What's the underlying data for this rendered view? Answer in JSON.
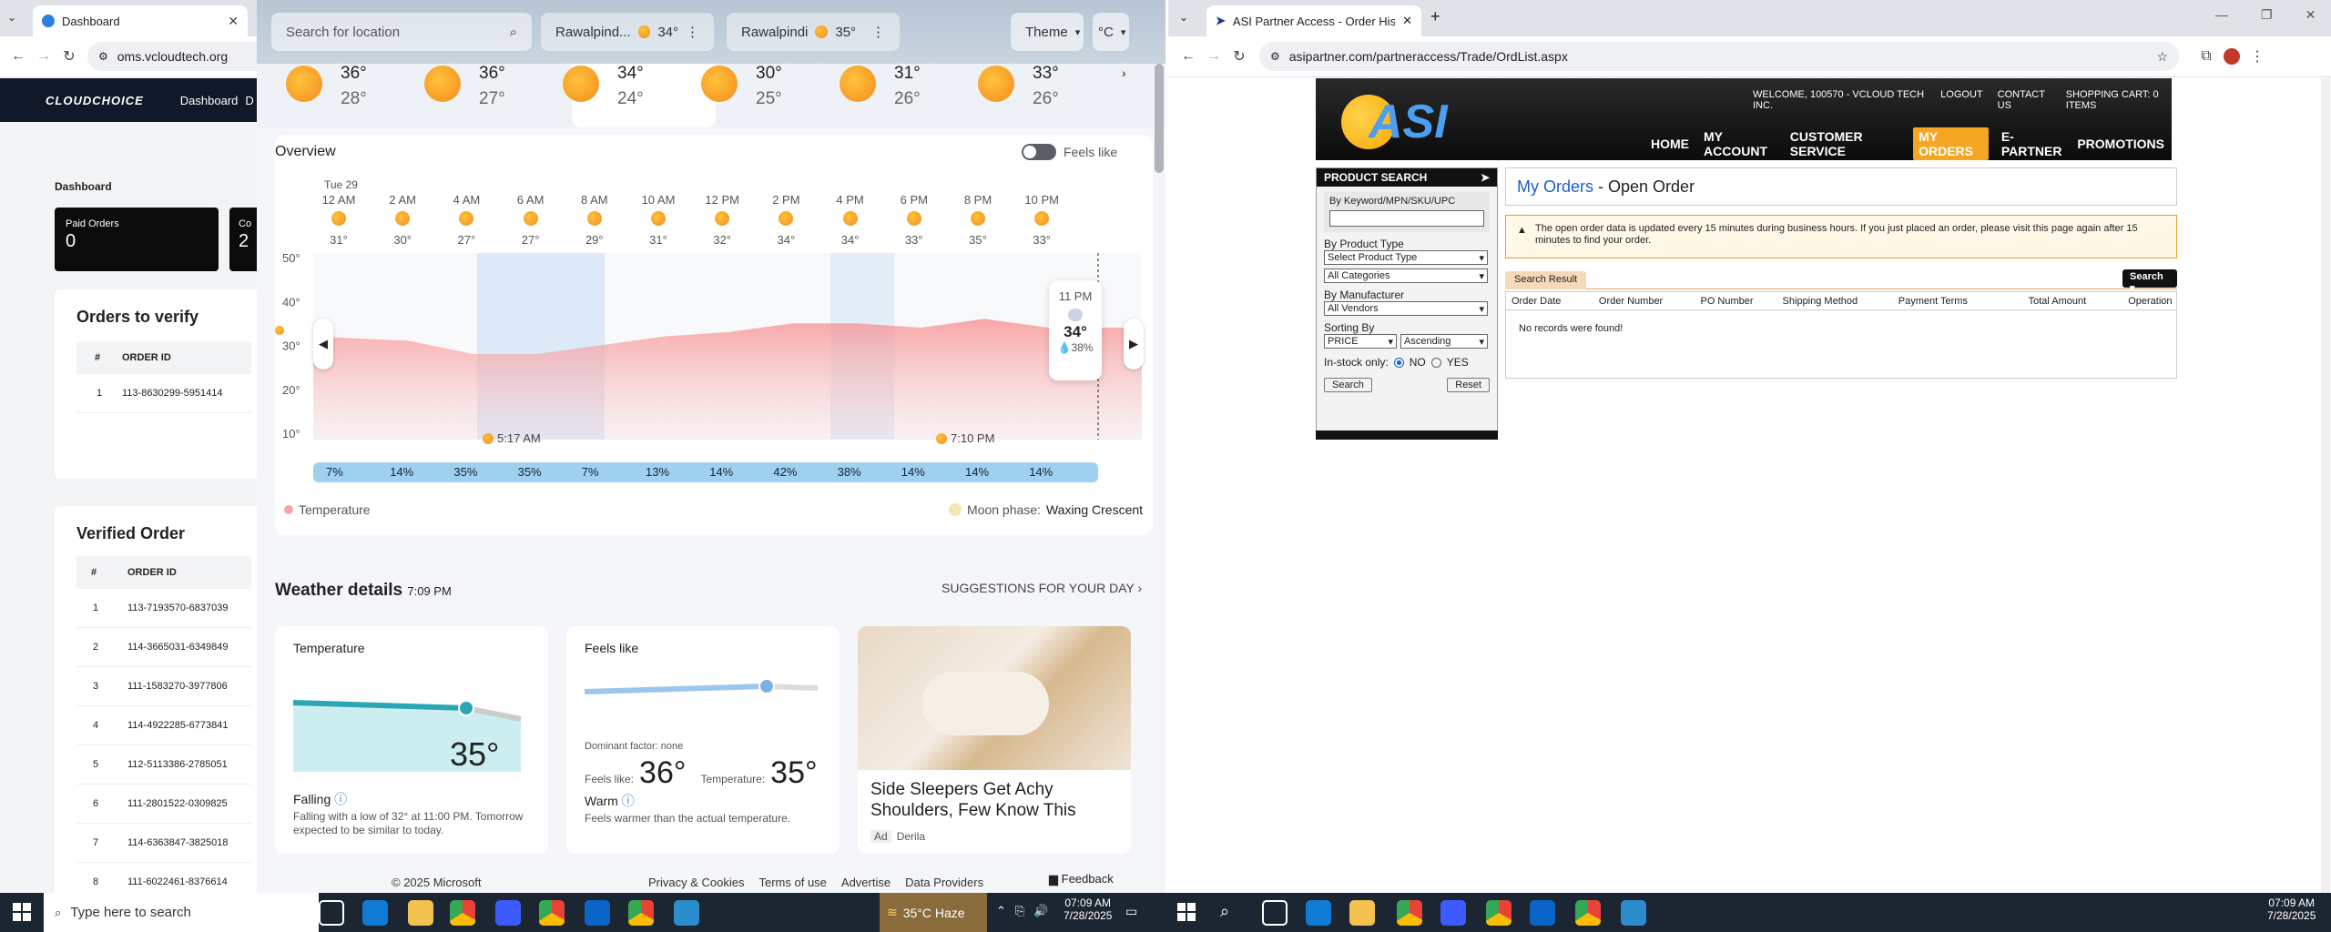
{
  "left_browser": {
    "tab_title": "Dashboard",
    "url": "oms.vcloudtech.org",
    "cc": {
      "logo": "CLOUDCHOICE",
      "nav_dashboard": "Dashboard",
      "nav_next": "D",
      "breadcrumb": "Dashboard",
      "paid_orders_label": "Paid Orders",
      "paid_orders_value": "0",
      "co_label": "Co",
      "co_value": "2",
      "orders_to_verify_title": "Orders to verify",
      "col_num": "#",
      "col_order_id": "ORDER ID",
      "verify_rows": [
        {
          "n": "1",
          "id": "113-8630299-5951414"
        }
      ],
      "verified_title": "Verified Order",
      "verified_rows": [
        {
          "n": "1",
          "id": "113-7193570-6837039"
        },
        {
          "n": "2",
          "id": "114-3665031-6349849"
        },
        {
          "n": "3",
          "id": "111-1583270-3977806"
        },
        {
          "n": "4",
          "id": "114-4922285-6773841"
        },
        {
          "n": "5",
          "id": "112-5113386-2785051"
        },
        {
          "n": "6",
          "id": "111-2801522-0309825"
        },
        {
          "n": "7",
          "id": "114-6363847-3825018"
        },
        {
          "n": "8",
          "id": "111-6022461-8376614"
        }
      ]
    }
  },
  "weather": {
    "search_placeholder": "Search for location",
    "loc1_name": "Rawalpind...",
    "loc1_temp": "34°",
    "loc2_name": "Rawalpindi",
    "loc2_temp": "35°",
    "theme_label": "Theme",
    "unit_label": "°C",
    "days": [
      {
        "hi": "36°",
        "lo": "28°"
      },
      {
        "hi": "36°",
        "lo": "27°"
      },
      {
        "hi": "34°",
        "lo": "24°"
      },
      {
        "hi": "30°",
        "lo": "25°"
      },
      {
        "hi": "31°",
        "lo": "26°"
      },
      {
        "hi": "33°",
        "lo": "26°"
      }
    ],
    "overview_title": "Overview",
    "feels_like_toggle": "Feels like",
    "date_label": "Tue 29",
    "hours": [
      {
        "t": "12 AM",
        "v": "31°"
      },
      {
        "t": "2 AM",
        "v": "30°"
      },
      {
        "t": "4 AM",
        "v": "27°"
      },
      {
        "t": "6 AM",
        "v": "27°"
      },
      {
        "t": "8 AM",
        "v": "29°"
      },
      {
        "t": "10 AM",
        "v": "31°"
      },
      {
        "t": "12 PM",
        "v": "32°"
      },
      {
        "t": "2 PM",
        "v": "34°"
      },
      {
        "t": "4 PM",
        "v": "34°"
      },
      {
        "t": "6 PM",
        "v": "33°"
      },
      {
        "t": "8 PM",
        "v": "35°"
      },
      {
        "t": "10 PM",
        "v": "33°"
      }
    ],
    "y_ticks": [
      "50°",
      "40°",
      "30°",
      "20°",
      "10°"
    ],
    "sunrise": "5:17 AM",
    "sunset": "7:10 PM",
    "tooltip_time": "11 PM",
    "tooltip_temp": "34°",
    "tooltip_rain": "38%",
    "rain": [
      "7%",
      "14%",
      "35%",
      "35%",
      "7%",
      "13%",
      "14%",
      "42%",
      "38%",
      "14%",
      "14%",
      "14%"
    ],
    "legend_temperature": "Temperature",
    "moon_label": "Moon phase:",
    "moon_value": "Waxing Crescent",
    "details_title": "Weather details",
    "details_time": "7:09 PM",
    "suggestions": "SUGGESTIONS FOR YOUR DAY",
    "temp_card_title": "Temperature",
    "temp_card_value": "35°",
    "temp_card_status": "Falling",
    "temp_card_desc": "Falling with a low of 32° at 11:00 PM. Tomorrow expected to be similar to today.",
    "feels_card_title": "Feels like",
    "dominant": "Dominant factor: none",
    "feels_label": "Feels like:",
    "feels_value": "36°",
    "temperature_label": "Temperature:",
    "temperature_value": "35°",
    "feels_status": "Warm",
    "feels_desc": "Feels warmer than the actual temperature.",
    "ad_title": "Side Sleepers Get Achy Shoulders, Few Know This",
    "ad_badge": "Ad",
    "ad_source": "Derila",
    "footer_copy": "© 2025 Microsoft",
    "footer_links": [
      "Privacy & Cookies",
      "Terms of use",
      "Advertise",
      "Data Providers"
    ],
    "feedback": "Feedback"
  },
  "right_browser": {
    "tab_title": "ASI Partner Access - Order Histo",
    "url": "asipartner.com/partneraccess/Trade/OrdList.aspx",
    "asi": {
      "logo": "ASI",
      "welcome": "WELCOME, 100570 - VCLOUD TECH INC.",
      "top_links": [
        "LOGOUT",
        "CONTACT US",
        "SHOPPING CART: 0 ITEMS"
      ],
      "nav": [
        "HOME",
        "MY ACCOUNT",
        "CUSTOMER SERVICE",
        "MY ORDERS",
        "E-PARTNER",
        "PROMOTIONS"
      ],
      "product_search": "PRODUCT SEARCH",
      "by_keyword": "By Keyword/MPN/SKU/UPC",
      "by_type": "By Product Type",
      "type_sel": "Select Product Type",
      "cat_sel": "All Categories",
      "by_manufacturer": "By Manufacturer",
      "vendor_sel": "All Vendors",
      "sorting": "Sorting By",
      "sort_sel": "PRICE",
      "order_sel": "Ascending",
      "instock": "In-stock only:",
      "no": "NO",
      "yes": "YES",
      "search_btn": "Search",
      "reset_btn": "Reset",
      "title_a": "My Orders",
      "title_b": " - Open Order",
      "notice": "The open order data is updated every 15 minutes during business hours. If you just placed an order, please visit this page again after 15 minutes to find your order.",
      "search_result_tab": "Search Result",
      "search_dropdown": "Search",
      "cols": [
        "Order Date",
        "Order Number",
        "PO Number",
        "Shipping Method",
        "Payment Terms",
        "Total Amount",
        "Operation"
      ],
      "empty": "No records were found!"
    }
  },
  "taskbar": {
    "search_placeholder": "Type here to search",
    "weather": "35°C  Haze",
    "time_left": "07:09 AM",
    "date_left": "7/28/2025",
    "time_right": "07:09 AM",
    "date_right": "7/28/2025"
  }
}
